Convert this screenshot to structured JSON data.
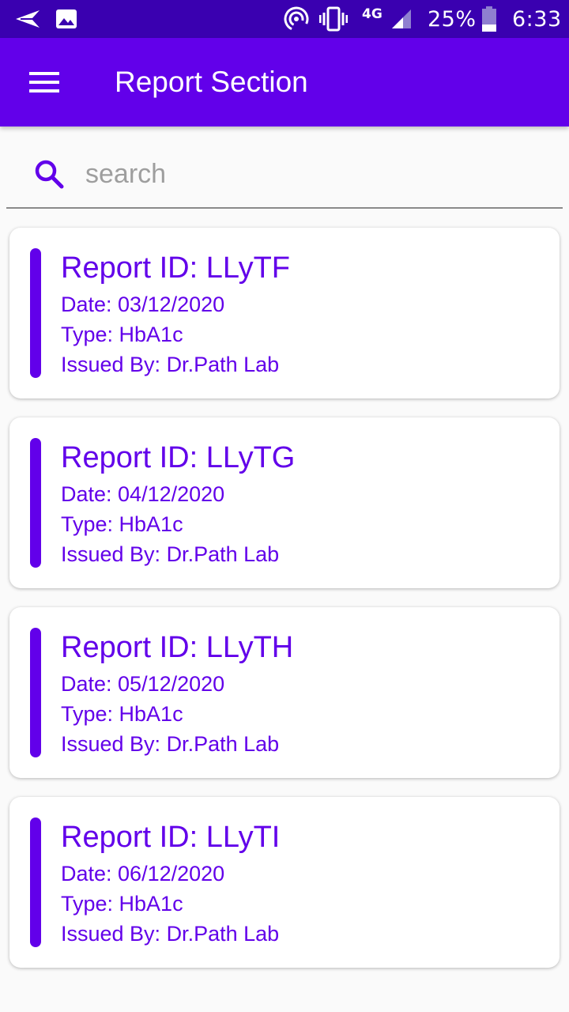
{
  "status_bar": {
    "network_type": "4G",
    "battery_percent": "25%",
    "time": "6:33",
    "icons": [
      "send-icon",
      "image-icon",
      "hotspot-icon",
      "vibrate-icon",
      "signal-icon",
      "battery-icon"
    ]
  },
  "app_bar": {
    "title": "Report Section",
    "menu_icon": "hamburger-menu-icon",
    "color": "#6200ea"
  },
  "search": {
    "placeholder": "search",
    "value": "",
    "icon": "search-icon"
  },
  "reports": [
    {
      "id_label": "Report ID: LLyTF",
      "date_label": "Date: 03/12/2020",
      "type_label": "Type: HbA1c",
      "issuer_label": "Issued By: Dr.Path Lab"
    },
    {
      "id_label": "Report ID: LLyTG",
      "date_label": "Date: 04/12/2020",
      "type_label": "Type: HbA1c",
      "issuer_label": "Issued By: Dr.Path Lab"
    },
    {
      "id_label": "Report ID: LLyTH",
      "date_label": "Date: 05/12/2020",
      "type_label": "Type: HbA1c",
      "issuer_label": "Issued By: Dr.Path Lab"
    },
    {
      "id_label": "Report ID: LLyTI",
      "date_label": "Date: 06/12/2020",
      "type_label": "Type: HbA1c",
      "issuer_label": "Issued By: Dr.Path Lab"
    }
  ],
  "colors": {
    "status_bar": "#3a00b0",
    "primary": "#6200ea",
    "background": "#fafafa"
  }
}
